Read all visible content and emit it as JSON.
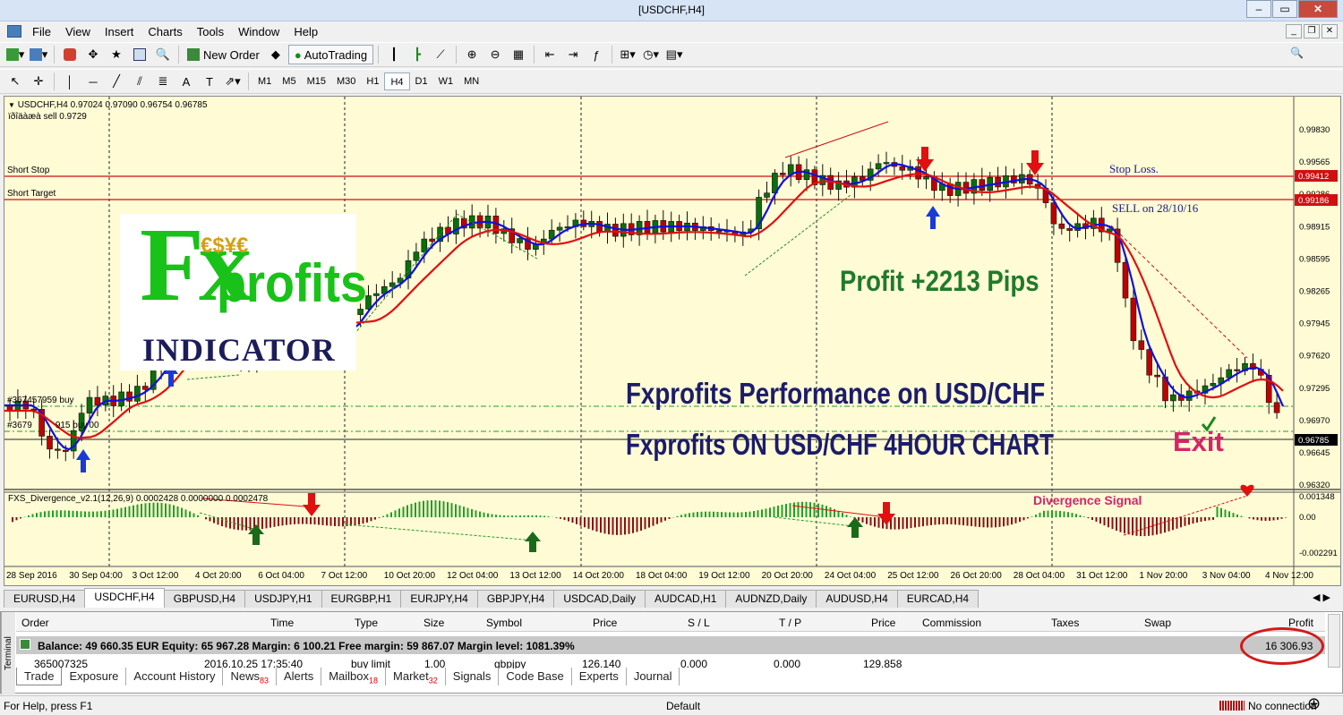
{
  "window": {
    "title": "[USDCHF,H4]"
  },
  "menu": [
    "File",
    "View",
    "Insert",
    "Charts",
    "Tools",
    "Window",
    "Help"
  ],
  "toolbar1": {
    "new_order": "New Order",
    "autotrading": "AutoTrading"
  },
  "timeframes": [
    "M1",
    "M5",
    "M15",
    "M30",
    "H1",
    "H4",
    "D1",
    "W1",
    "MN"
  ],
  "active_timeframe": "H4",
  "chart": {
    "header": "USDCHF,H4  0.97024 0.97090 0.96754 0.96785",
    "subheader": "ïðîäàæà sell 0.9729",
    "short_stop": "Short Stop",
    "short_target": "Short Target",
    "stop_loss": "Stop Loss.",
    "sell_note": "SELL on 28/10/16",
    "profit": "Profit  +2213 Pips",
    "perf_line1": "Fxprofits Performance on USD/CHF",
    "perf_line2": "Fxprofits ON USD/CHF 4HOUR CHART",
    "exit": "Exit",
    "order1": "#367457959 buy",
    "order2": "#3679",
    "order2b": "915 buy",
    "order2c": "00",
    "price_ticks": [
      "0.99830",
      "0.99565",
      "0.99286",
      "0.98915",
      "0.98595",
      "0.98265",
      "0.97945",
      "0.97620",
      "0.97295",
      "0.96970",
      "0.96645",
      "0.96320"
    ],
    "price_labels": {
      "stop": "0.99412",
      "target": "0.99186",
      "current": "0.96785"
    },
    "indicator_header": "FXS_Divergence_v2.1(12,26,9) 0.0002428 0.0000000 0.0002478",
    "indicator_ticks": [
      "0.001348",
      "0.00",
      "-0.002291"
    ],
    "divergence_signal": "Divergence Signal",
    "time_ticks": [
      "28 Sep 2016",
      "30 Sep 04:00",
      "3 Oct 12:00",
      "4 Oct 20:00",
      "6 Oct 04:00",
      "7 Oct 12:00",
      "10 Oct 20:00",
      "12 Oct 04:00",
      "13 Oct 12:00",
      "14 Oct 20:00",
      "18 Oct 04:00",
      "19 Oct 12:00",
      "20 Oct 20:00",
      "24 Oct 04:00",
      "25 Oct 12:00",
      "26 Oct 20:00",
      "28 Oct 04:00",
      "31 Oct 12:00",
      "1 Nov 20:00",
      "3 Nov 04:00",
      "4 Nov 12:00"
    ]
  },
  "logo": {
    "line1": "Fx",
    "line2": "profits",
    "line3": "INDICATOR",
    "coins": "€$¥€"
  },
  "chart_tabs": [
    "EURUSD,H4",
    "USDCHF,H4",
    "GBPUSD,H4",
    "USDJPY,H1",
    "EURGBP,H1",
    "EURJPY,H4",
    "GBPJPY,H4",
    "USDCAD,Daily",
    "AUDCAD,H1",
    "AUDNZD,Daily",
    "AUDUSD,H4",
    "EURCAD,H4"
  ],
  "active_chart_tab": "USDCHF,H4",
  "terminal": {
    "label": "Terminal",
    "columns": [
      "Order",
      "Time",
      "Type",
      "Size",
      "Symbol",
      "Price",
      "S / L",
      "T / P",
      "Price",
      "Commission",
      "Taxes",
      "Swap",
      "Profit"
    ],
    "balance_line": "Balance: 49 660.35 EUR  Equity: 65 967.28  Margin: 6 100.21  Free margin: 59 867.07  Margin level: 1081.39%",
    "total_profit": "16 306.93",
    "trade_row": {
      "order": "365007325",
      "time": "2016.10.25 17:35:40",
      "type": "buy limit",
      "size": "1.00",
      "symbol": "gbpjpy",
      "price": "126.140",
      "sl": "0.000",
      "tp": "0.000",
      "price2": "129.858"
    },
    "tabs": [
      {
        "label": "Trade"
      },
      {
        "label": "Exposure"
      },
      {
        "label": "Account History"
      },
      {
        "label": "News",
        "badge": "83"
      },
      {
        "label": "Alerts"
      },
      {
        "label": "Mailbox",
        "badge": "18"
      },
      {
        "label": "Market",
        "badge": "32"
      },
      {
        "label": "Signals"
      },
      {
        "label": "Code Base"
      },
      {
        "label": "Experts"
      },
      {
        "label": "Journal"
      }
    ]
  },
  "status": {
    "help": "For Help, press F1",
    "profile": "Default",
    "connection": "No connection"
  },
  "colors": {
    "chart_bg": "#fefbd5",
    "bull": "#0a6e0a",
    "bear": "#c00000",
    "blue_ma": "#1010e0",
    "red_ma": "#e01010",
    "logo_green": "#19c219",
    "logo_red": "#d61e1e",
    "profit_green": "#217a2a",
    "perf_navy": "#1c1c6a",
    "exit_pink": "#d6246a"
  }
}
